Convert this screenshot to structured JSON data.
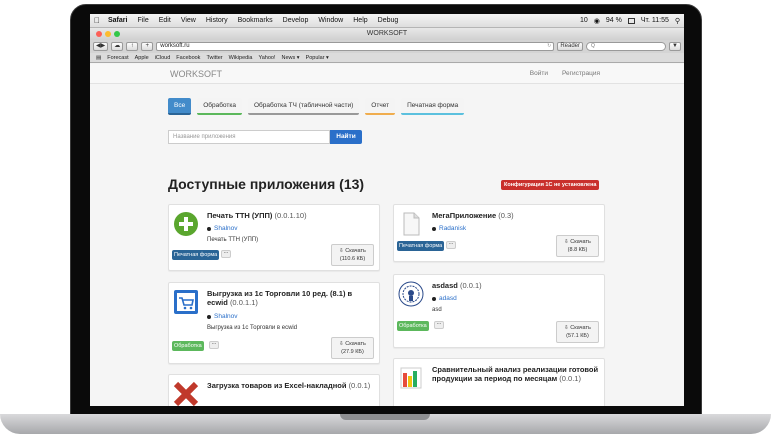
{
  "menubar": {
    "app": "Safari",
    "items": [
      "File",
      "Edit",
      "View",
      "History",
      "Bookmarks",
      "Develop",
      "Window",
      "Help",
      "Debug"
    ],
    "battery": "94 %",
    "clock": "Чт. 11:55",
    "notif": "10"
  },
  "window": {
    "title": "WORKSOFT"
  },
  "toolbar": {
    "url": "worksoft.ru",
    "reader": "Reader"
  },
  "bookmarks": [
    "Forecast",
    "Apple",
    "iCloud",
    "Facebook",
    "Twitter",
    "Wikipedia",
    "Yahoo!",
    "News ▾",
    "Popular ▾"
  ],
  "site": {
    "brand": "WORKSOFT",
    "login": "Войти",
    "register": "Регистрация"
  },
  "filters": [
    "Все",
    "Обработка",
    "Обработка ТЧ (табличной части)",
    "Отчет",
    "Печатная форма"
  ],
  "search": {
    "placeholder": "Название приложения",
    "button": "Найти"
  },
  "heading": "Доступные приложения (13)",
  "warning": "Конфигурация 1С не установлена",
  "cards": [
    {
      "name": "Печать ТТН (УПП)",
      "version": "(0.0.1.10)",
      "author": "Shalnov",
      "desc": "Печать ТТН (УПП)",
      "tag": "Печатная форма",
      "download": "Скачать",
      "size": "(110.6 КБ)"
    },
    {
      "name": "Выгрузка из 1с Торговли 10 ред. (8.1) в ecwid",
      "version": "(0.0.1.1)",
      "author": "Shalnov",
      "desc": "Выгрузка из 1с Торговли в ecwid",
      "tag": "Обработка",
      "download": "Скачать",
      "size": "(27.9 КБ)"
    },
    {
      "name": "Загрузка товаров из Excel-накладной",
      "version": "(0.0.1)",
      "author": "",
      "desc": "",
      "tag": "",
      "download": "",
      "size": ""
    },
    {
      "name": "МегаПриложение",
      "version": "(0.3)",
      "author": "Radanisk",
      "desc": "",
      "tag": "Печатная форма",
      "download": "Скачать",
      "size": "(8.8 КБ)"
    },
    {
      "name": "asdasd",
      "version": "(0.0.1)",
      "author": "adasd",
      "desc": "asd",
      "tag": "Обработка",
      "download": "Скачать",
      "size": "(57.1 КБ)"
    },
    {
      "name": "Сравнительный анализ реализации готовой продукции за период по месяцам",
      "version": "(0.0.1)",
      "author": "",
      "desc": "",
      "tag": "",
      "download": "",
      "size": ""
    }
  ],
  "colors": {
    "primary": "#428bca",
    "find": "#2a6fc9",
    "danger": "#c9302c",
    "tag_print": "#2a6496",
    "tag_proc": "#5cb85c"
  }
}
